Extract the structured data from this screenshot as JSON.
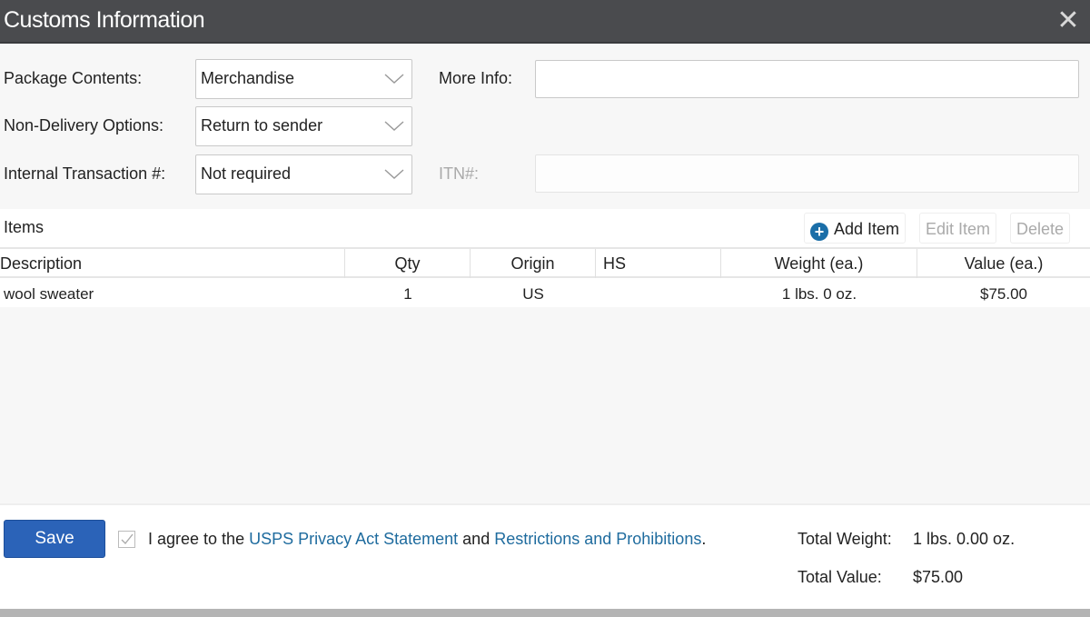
{
  "dialog": {
    "title": "Customs Information",
    "close_icon": "close-icon"
  },
  "form": {
    "package_contents": {
      "label": "Package Contents:",
      "value": "Merchandise"
    },
    "non_delivery": {
      "label": "Non-Delivery Options:",
      "value": "Return to sender"
    },
    "internal_transaction": {
      "label": "Internal Transaction #:",
      "value": "Not required"
    },
    "more_info": {
      "label": "More Info:",
      "value": ""
    },
    "itn": {
      "label": "ITN#:",
      "value": ""
    }
  },
  "items": {
    "title": "Items",
    "add_label": "Add Item",
    "edit_label": "Edit Item",
    "delete_label": "Delete",
    "columns": [
      "Description",
      "Qty",
      "Origin",
      "HS",
      "Weight (ea.)",
      "Value (ea.)"
    ],
    "rows": [
      {
        "description": "wool sweater",
        "qty": "1",
        "origin": "US",
        "hs": "",
        "weight": "1 lbs. 0 oz.",
        "value": "$75.00"
      }
    ]
  },
  "footer": {
    "save_label": "Save",
    "agree_checked": true,
    "agree_prefix": "I agree to the ",
    "privacy_link": "USPS Privacy Act Statement",
    "agree_and": " and ",
    "restrictions_link": "Restrictions and Prohibitions",
    "agree_suffix": ".",
    "total_weight_label": "Total Weight:",
    "total_weight_value": "1 lbs. 0.00 oz.",
    "total_value_label": "Total Value:",
    "total_value_value": "$75.00"
  },
  "colors": {
    "titlebar": "#4a4b4e",
    "primary_button": "#2b63b8",
    "link": "#1e6b9e",
    "add_icon": "#1a6ea8"
  }
}
